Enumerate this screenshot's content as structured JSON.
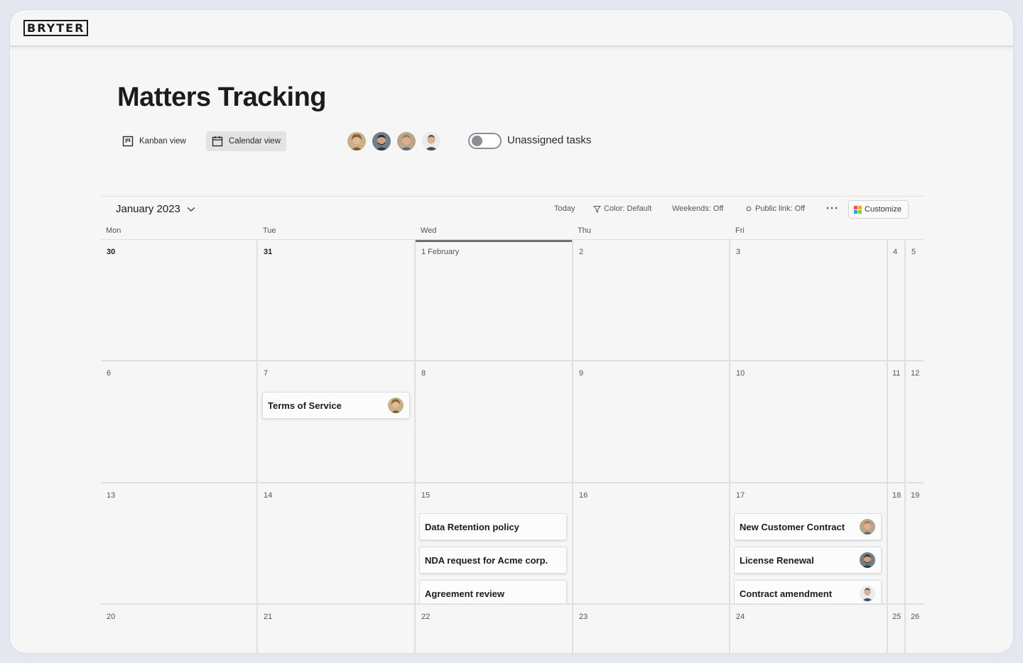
{
  "brand": {
    "logo_text": "BRYTER"
  },
  "page": {
    "title": "Matters Tracking"
  },
  "views": {
    "kanban_label": "Kanban view",
    "calendar_label": "Calendar view"
  },
  "team": {
    "avatars": [
      "avatar-1",
      "avatar-2",
      "avatar-3",
      "avatar-4"
    ]
  },
  "unassigned": {
    "label": "Unassigned tasks",
    "enabled": false
  },
  "toolbar": {
    "month": "January 2023",
    "today": "Today",
    "color": "Color: Default",
    "weekends": "Weekends: Off",
    "public_link": "Public link: Off",
    "customize": "Customize"
  },
  "days_of_week": [
    "Mon",
    "Tue",
    "Wed",
    "Thu",
    "Fri"
  ],
  "weeks": [
    [
      "30",
      "31",
      "1 February",
      "2",
      "3",
      "4",
      "5"
    ],
    [
      "6",
      "7",
      "8",
      "9",
      "10",
      "11",
      "12"
    ],
    [
      "13",
      "14",
      "15",
      "16",
      "17",
      "18",
      "19"
    ],
    [
      "20",
      "21",
      "22",
      "23",
      "24",
      "25",
      "26"
    ]
  ],
  "tasks": {
    "terms_of_service": "Terms of Service",
    "data_retention": "Data Retention policy",
    "nda_request": "NDA request for Acme corp.",
    "agreement_review": "Agreement review",
    "new_customer_contract": "New Customer Contract",
    "license_renewal": "License Renewal",
    "contract_amendment": "Contract amendment"
  },
  "colors": {
    "accent_selected": "#e2e3e5",
    "today_marker": "#707070",
    "customize_icon": [
      "#e2574c",
      "#f5a623",
      "#4a90e2",
      "#7ed321"
    ]
  }
}
